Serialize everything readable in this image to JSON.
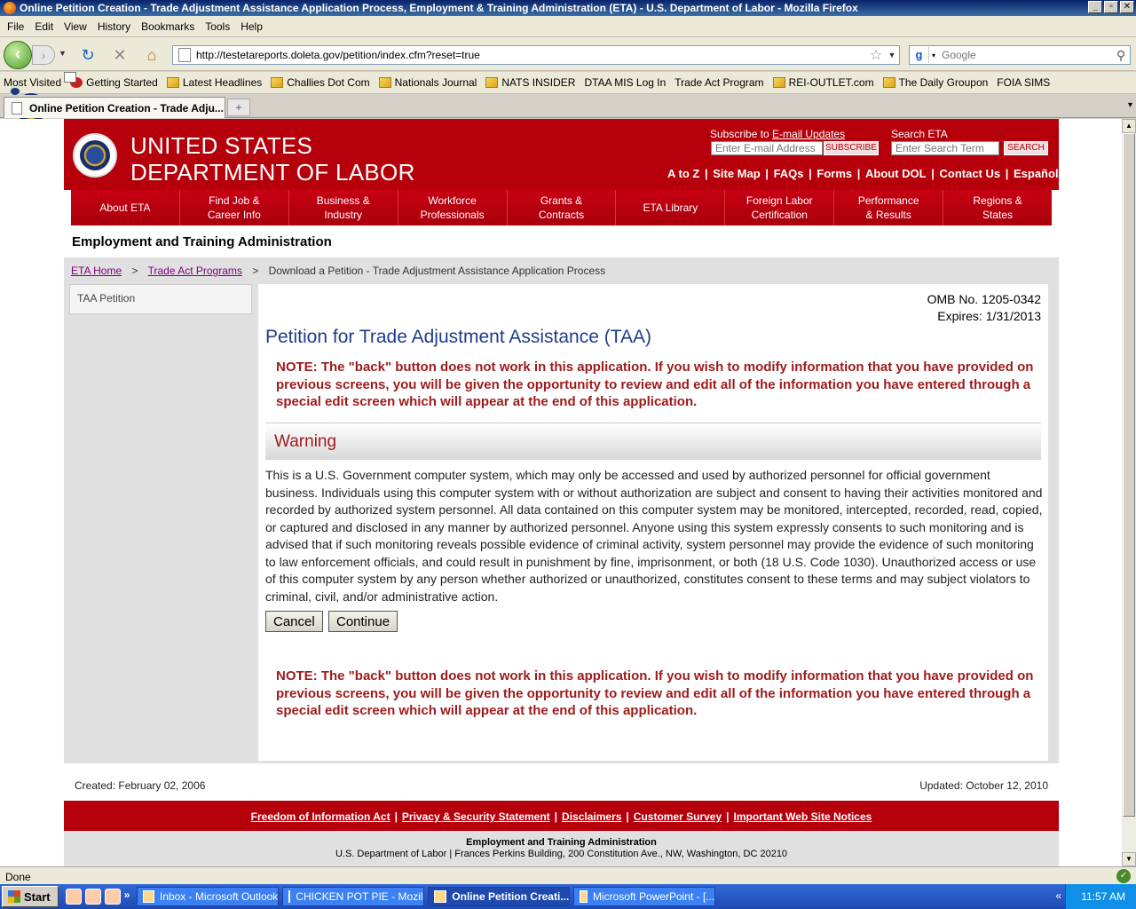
{
  "window": {
    "title": "Online Petition Creation - Trade Adjustment Assistance Application Process, Employment & Training Administration (ETA) - U.S. Department of Labor - Mozilla Firefox"
  },
  "menu": [
    "File",
    "Edit",
    "View",
    "History",
    "Bookmarks",
    "Tools",
    "Help"
  ],
  "nav": {
    "url": "http://testetareports.doleta.gov/petition/index.cfm?reset=true",
    "search_placeholder": "Google"
  },
  "bookmarks": [
    {
      "label": "Most Visited",
      "icon": "page"
    },
    {
      "label": "Getting Started",
      "icon": "ff"
    },
    {
      "label": "Latest Headlines",
      "icon": "folder"
    },
    {
      "label": "Challies Dot Com",
      "icon": "folder"
    },
    {
      "label": "Nationals Journal",
      "icon": "folder"
    },
    {
      "label": "NATS INSIDER",
      "icon": "folder"
    },
    {
      "label": "DTAA MIS Log In",
      "icon": "page"
    },
    {
      "label": "Trade Act Program",
      "icon": "seal"
    },
    {
      "label": "REI-OUTLET.com",
      "icon": "folder"
    },
    {
      "label": "The Daily Groupon",
      "icon": "folder"
    },
    {
      "label": "FOIA SIMS",
      "icon": "page"
    }
  ],
  "tab": {
    "label": "Online Petition Creation - Trade Adju...",
    "new_tab": "+"
  },
  "header": {
    "line1": "UNITED STATES",
    "line2": "DEPARTMENT OF LABOR",
    "subscribe_prefix": "Subscribe to ",
    "subscribe_link": "E-mail Updates",
    "email_placeholder": "Enter E-mail Address",
    "subscribe_btn": "SUBSCRIBE",
    "search_label": "Search ETA",
    "search_placeholder": "Enter Search Term",
    "search_btn": "SEARCH",
    "links": [
      "A to Z",
      "Site Map",
      "FAQs",
      "Forms",
      "About DOL",
      "Contact Us",
      "Español"
    ]
  },
  "mainnav": [
    [
      "About ETA"
    ],
    [
      "Find Job &",
      "Career Info"
    ],
    [
      "Business &",
      "Industry"
    ],
    [
      "Workforce",
      "Professionals"
    ],
    [
      "Grants &",
      "Contracts"
    ],
    [
      "ETA Library"
    ],
    [
      "Foreign Labor",
      "Certification"
    ],
    [
      "Performance",
      "& Results"
    ],
    [
      "Regions &",
      "States"
    ]
  ],
  "agency": "Employment and Training Administration",
  "breadcrumb": {
    "home": "ETA Home",
    "sep": ">",
    "programs": "Trade Act Programs",
    "current": "Download a Petition - Trade Adjustment Assistance Application Process"
  },
  "sidebar": {
    "item": "TAA Petition"
  },
  "content": {
    "omb_no": "OMB No. 1205-0342",
    "expires": "Expires: 1/31/2013",
    "title": "Petition for Trade Adjustment Assistance (TAA)",
    "note": "NOTE: The \"back\" button does not work in this application. If you wish to modify information that you have provided on previous screens, you will be given the opportunity to review and edit all of the information you have entered through a special edit screen which will appear at the end of this application.",
    "warning_heading": "Warning",
    "warning_text": "This is a U.S. Government computer system, which may only be accessed and used by authorized personnel for official government business. Individuals using this computer system with or without authorization are subject and consent to having their activities monitored and recorded by authorized system personnel. All data contained on this computer system may be monitored, intercepted, recorded, read, copied, or captured and disclosed in any manner by authorized personnel. Anyone using this system expressly consents to such monitoring and is advised that if such monitoring reveals possible evidence of criminal activity, system personnel may provide the evidence of such monitoring to law enforcement officials, and could result in punishment by fine, imprisonment, or both (18 U.S. Code 1030). Unauthorized access or use of this computer system by any person whether authorized or unauthorized, constitutes consent to these terms and may subject violators to criminal, civil, and/or administrative action.",
    "cancel": "Cancel",
    "continue": "Continue"
  },
  "footer": {
    "created": "Created: February 02, 2006",
    "updated": "Updated: October 12, 2010",
    "links": [
      "Freedom of Information Act",
      "Privacy & Security Statement",
      "Disclaimers",
      "Customer Survey",
      "Important Web Site Notices"
    ],
    "org": "Employment and Training Administration",
    "address": "U.S. Department of Labor | Frances Perkins Building, 200 Constitution Ave., NW, Washington, DC 20210"
  },
  "status": "Done",
  "taskbar": {
    "start": "Start",
    "more": "»",
    "tasks": [
      "Inbox - Microsoft Outlook",
      "CHICKEN POT PIE - Mozil...",
      "Online Petition Creati...",
      "Microsoft PowerPoint - [..."
    ],
    "active_index": 2,
    "clock": "11:57 AM"
  },
  "colors": {
    "dol_red": "#b5000b",
    "title_blue": "#1f3c8a",
    "note_red": "#9e1a1a",
    "visited_link": "#800080"
  }
}
